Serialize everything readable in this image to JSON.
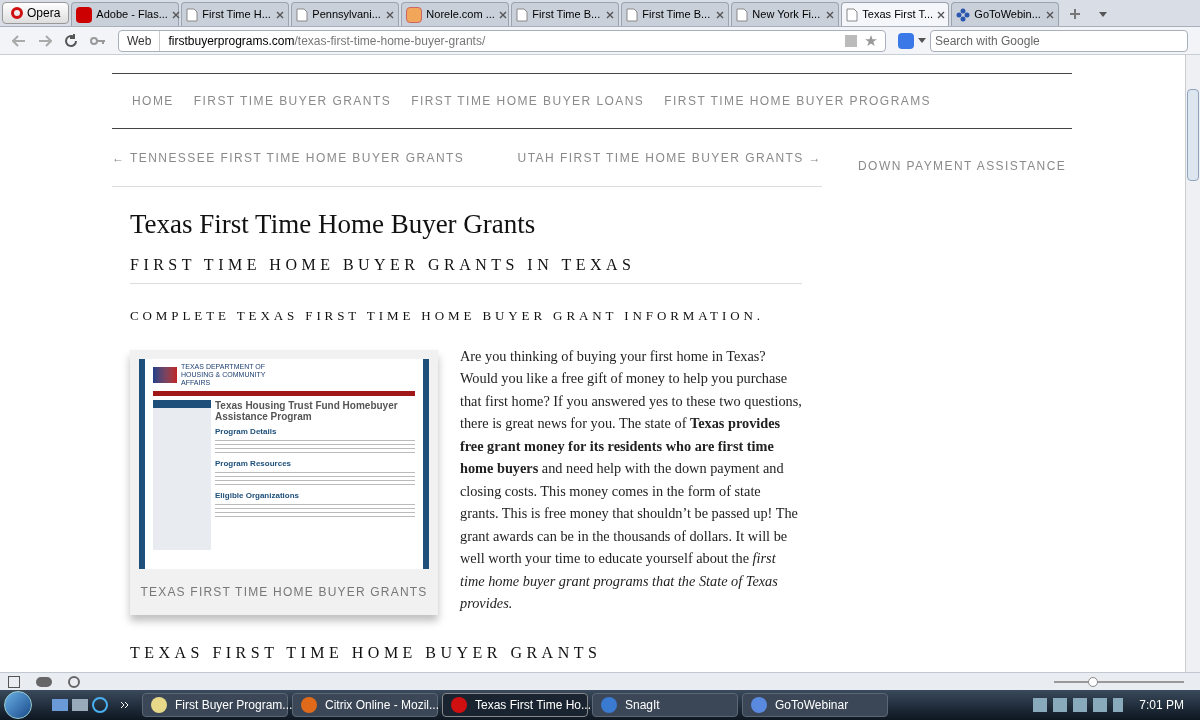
{
  "browser": {
    "menu_button": "Opera",
    "tabs": [
      {
        "label": "Adobe - Flas...",
        "kind": "adobe",
        "selected": false
      },
      {
        "label": "First Time H...",
        "kind": "page",
        "selected": false
      },
      {
        "label": "Pennsylvani...",
        "kind": "page",
        "selected": false
      },
      {
        "label": "Norele.com ...",
        "kind": "norele",
        "selected": false
      },
      {
        "label": "First Time B...",
        "kind": "page",
        "selected": false
      },
      {
        "label": "First Time B...",
        "kind": "page",
        "selected": false
      },
      {
        "label": "New York Fi...",
        "kind": "page",
        "selected": false
      },
      {
        "label": "Texas First T...",
        "kind": "page",
        "selected": true
      },
      {
        "label": "GoToWebin...",
        "kind": "webinar",
        "selected": false
      }
    ],
    "address": {
      "badge": "Web",
      "domain": "firstbuyerprograms.com",
      "path": "/texas-first-time-home-buyer-grants/"
    },
    "search": {
      "placeholder": "Search with Google"
    }
  },
  "page": {
    "nav": [
      "HOME",
      "FIRST TIME BUYER GRANTS",
      "FIRST TIME HOME BUYER LOANS",
      "FIRST TIME HOME BUYER PROGRAMS"
    ],
    "prev_post": "← TENNESSEE FIRST TIME HOME BUYER GRANTS",
    "next_post": "UTAH FIRST TIME HOME BUYER GRANTS →",
    "sidebar_heading": "DOWN PAYMENT ASSISTANCE",
    "title": "Texas First Time Home Buyer Grants",
    "heading": "FIRST TIME HOME BUYER GRANTS IN TEXAS",
    "subheading": "COMPLETE TEXAS FIRST TIME HOME BUYER GRANT INFORMATION.",
    "figure": {
      "caption": "TEXAS FIRST TIME HOME BUYER GRANTS",
      "shot": {
        "agency": "TEXAS DEPARTMENT OF HOUSING & COMMUNITY AFFAIRS",
        "title": "Texas Housing Trust Fund Homebuyer Assistance Program",
        "sections": [
          "Program Details",
          "Program Resources",
          "Eligible Organizations"
        ]
      }
    },
    "paragraph": "Are you thinking of buying your first home in Texas? Would you like a free gift of money to help you purchase that first home? If you answered yes to these two questions, there is great news for you. The state of **Texas provides free grant money for its residents who are first time home buyers** and need help with the down payment and closing costs. This money comes in the form of state grants. This is free money that shouldn’t be passed up! The grant awards can be in the thousands of dollars. It will be well worth your time to educate yourself about the *first time home buyer grant programs that the State of Texas provides.*",
    "next_heading": "TEXAS FIRST TIME HOME BUYER GRANTS"
  },
  "status_bar": {
    "zoom": {
      "level": 0.3
    }
  },
  "taskbar": {
    "items": [
      {
        "label": "First Buyer Program...",
        "kind": "doc",
        "selected": false
      },
      {
        "label": "Citrix Online - Mozil...",
        "kind": "firefox",
        "selected": false
      },
      {
        "label": "Texas First Time Ho...",
        "kind": "opera",
        "selected": true
      },
      {
        "label": "SnagIt",
        "kind": "snagit",
        "selected": false
      },
      {
        "label": "GoToWebinar",
        "kind": "webinar",
        "selected": false
      }
    ],
    "clock": "7:01 PM"
  }
}
